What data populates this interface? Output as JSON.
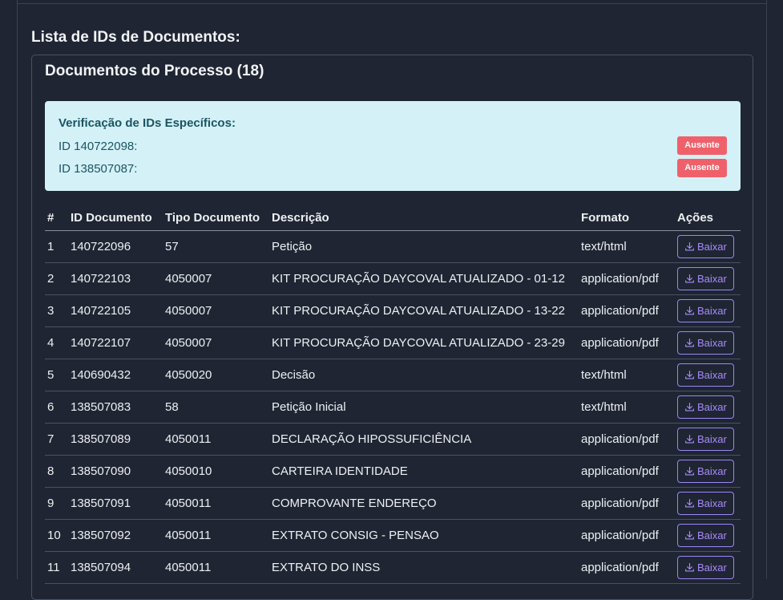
{
  "section_title": "Lista de IDs de Documentos:",
  "card": {
    "title": "Documentos do Processo (18)",
    "alert": {
      "title": "Verificação de IDs Específicos:",
      "checks": [
        {
          "label": "ID 140722098:",
          "status": "Ausente"
        },
        {
          "label": "ID 138507087:",
          "status": "Ausente"
        }
      ]
    }
  },
  "table": {
    "headers": [
      "#",
      "ID Documento",
      "Tipo Documento",
      "Descrição",
      "Formato",
      "Ações"
    ],
    "action_label": "Baixar",
    "rows": [
      [
        "1",
        "140722096",
        "57",
        "Petição",
        "text/html"
      ],
      [
        "2",
        "140722103",
        "4050007",
        "KIT PROCURAÇÃO DAYCOVAL ATUALIZADO - 01-12",
        "application/pdf"
      ],
      [
        "3",
        "140722105",
        "4050007",
        "KIT PROCURAÇÃO DAYCOVAL ATUALIZADO - 13-22",
        "application/pdf"
      ],
      [
        "4",
        "140722107",
        "4050007",
        "KIT PROCURAÇÃO DAYCOVAL ATUALIZADO - 23-29",
        "application/pdf"
      ],
      [
        "5",
        "140690432",
        "4050020",
        "Decisão",
        "text/html"
      ],
      [
        "6",
        "138507083",
        "58",
        "Petição Inicial",
        "text/html"
      ],
      [
        "7",
        "138507089",
        "4050011",
        "DECLARAÇÃO HIPOSSUFICIÊNCIA",
        "application/pdf"
      ],
      [
        "8",
        "138507090",
        "4050010",
        "CARTEIRA IDENTIDADE",
        "application/pdf"
      ],
      [
        "9",
        "138507091",
        "4050011",
        "COMPROVANTE ENDEREÇO",
        "application/pdf"
      ],
      [
        "10",
        "138507092",
        "4050011",
        "EXTRATO CONSIG - PENSAO",
        "application/pdf"
      ],
      [
        "11",
        "138507094",
        "4050011",
        "EXTRATO DO INSS",
        "application/pdf"
      ]
    ]
  },
  "colors": {
    "background": "#1f2533",
    "alert_bg": "#d4f1f7",
    "badge": "#f0606a",
    "button_accent": "#a78bfa"
  },
  "icons": {
    "download": "download-icon"
  }
}
